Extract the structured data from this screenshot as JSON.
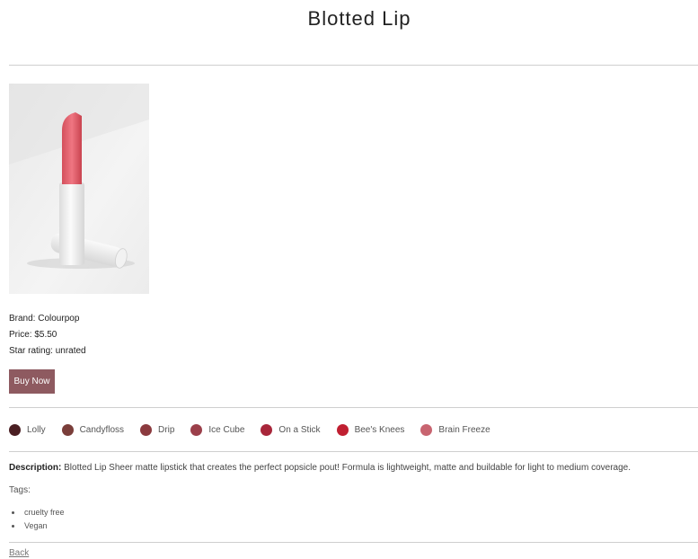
{
  "page": {
    "title": "Blotted Lip"
  },
  "product": {
    "image_alt": "Blotted Lip",
    "brand_text": "Brand: Colourpop",
    "price_text": "Price: $5.50",
    "rating_text": "Star rating: unrated",
    "buy_label": "Buy Now"
  },
  "swatches": [
    {
      "name": "Lolly",
      "color": "#4a1e22"
    },
    {
      "name": "Candyfloss",
      "color": "#7a3e3a"
    },
    {
      "name": "Drip",
      "color": "#8b3a3e"
    },
    {
      "name": "Ice Cube",
      "color": "#9b3f4a"
    },
    {
      "name": "On a Stick",
      "color": "#a8263a"
    },
    {
      "name": "Bee's Knees",
      "color": "#c01f31"
    },
    {
      "name": "Brain Freeze",
      "color": "#c86470"
    }
  ],
  "description": {
    "label": "Description:",
    "text": " Blotted Lip Sheer matte lipstick that creates the perfect popsicle pout! Formula is lightweight, matte and buildable for light to medium coverage."
  },
  "tags": {
    "label": "Tags:",
    "items": [
      "cruelty free",
      "Vegan"
    ]
  },
  "nav": {
    "back_label": "Back"
  },
  "colors": {
    "button_bg": "#8e5a60",
    "rule": "#cfcfcf"
  }
}
